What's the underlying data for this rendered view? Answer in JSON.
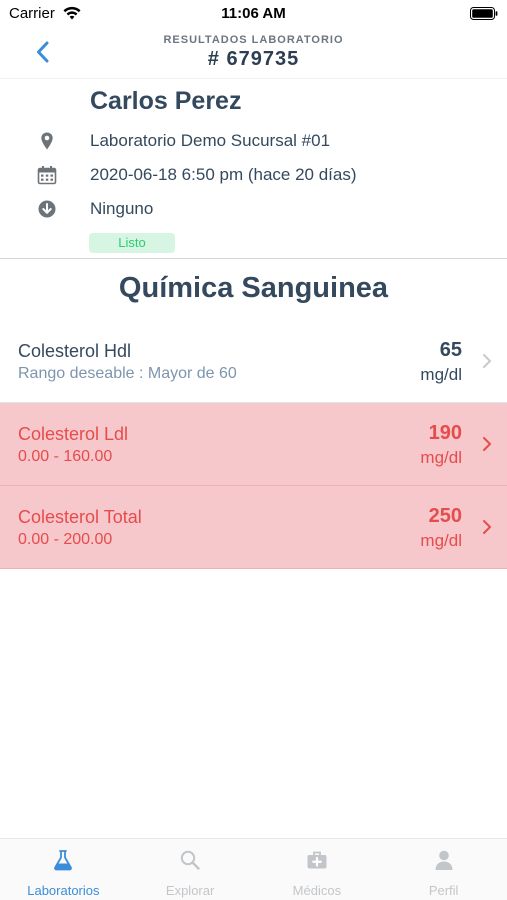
{
  "status_bar": {
    "carrier": "Carrier",
    "time": "11:06 AM"
  },
  "nav": {
    "back_icon": "chevron-left-icon",
    "subtitle": "RESULTADOS LABORATORIO",
    "title": "# 679735"
  },
  "patient": {
    "name": "Carlos Perez",
    "location": {
      "icon": "map-pin-icon",
      "text": "Laboratorio Demo Sucursal #01"
    },
    "date": {
      "icon": "calendar-icon",
      "text": "2020-06-18 6:50 pm (hace 20 días)"
    },
    "delivery": {
      "icon": "arrow-down-circle-icon",
      "text": "Ninguno"
    },
    "status": "Listo"
  },
  "section": {
    "title": "Química Sanguinea"
  },
  "results": [
    {
      "name": "Colesterol Hdl",
      "range": "Rango deseable : Mayor de 60",
      "value": "65",
      "unit": "mg/dl",
      "abnormal": false
    },
    {
      "name": "Colesterol Ldl",
      "range": "0.00 - 160.00",
      "value": "190",
      "unit": "mg/dl",
      "abnormal": true
    },
    {
      "name": "Colesterol Total",
      "range": "0.00 - 200.00",
      "value": "250",
      "unit": "mg/dl",
      "abnormal": true
    }
  ],
  "tabs": [
    {
      "label": "Laboratorios",
      "icon": "flask-icon",
      "active": true
    },
    {
      "label": "Explorar",
      "icon": "search-icon",
      "active": false
    },
    {
      "label": "Médicos",
      "icon": "medical-kit-icon",
      "active": false
    },
    {
      "label": "Perfil",
      "icon": "user-icon",
      "active": false
    }
  ],
  "colors": {
    "accent": "#3c8dd9",
    "text": "#34495e",
    "abnormal_text": "#e74c4c",
    "abnormal_bg": "#f6c7cb",
    "status_ok_bg": "#d6f5e3",
    "status_ok_text": "#2ecc71"
  }
}
